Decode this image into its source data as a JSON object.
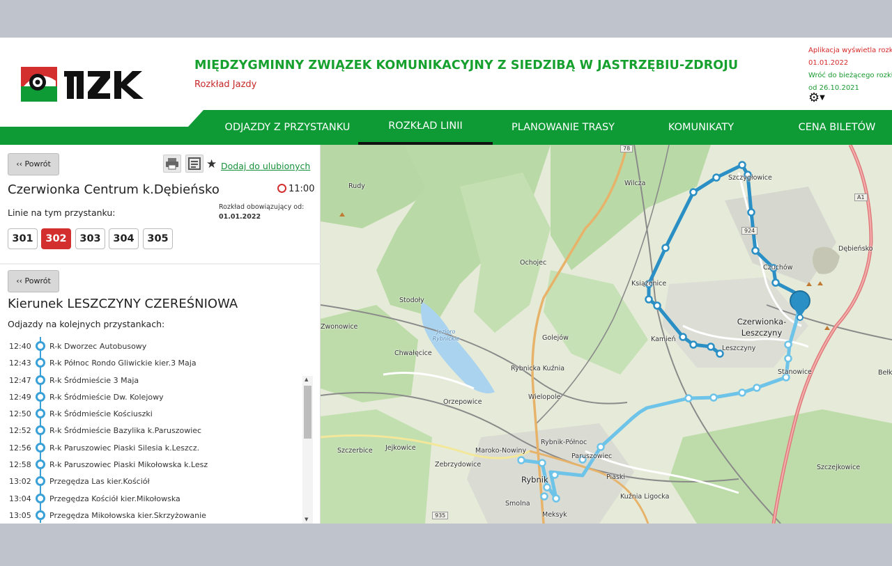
{
  "header": {
    "logo_text": "MZK",
    "org_title": "MIĘDZYGMINNY ZWIĄZEK KOMUNIKACYJNY Z SIEDZIBĄ W JASTRZĘBIU-ZDROJU",
    "org_subtitle": "Rozkład Jazdy",
    "notice_line1": "Aplikacja wyświetla rozkł",
    "notice_line2": "01.01.2022",
    "notice_line3": "Wróć do bieżącego rozkła",
    "notice_line4": "od 26.10.2021"
  },
  "nav": {
    "items": [
      "ODJAZDY Z PRZYSTANKU",
      "ROZKŁAD LINII",
      "PLANOWANIE TRASY",
      "KOMUNIKATY",
      "CENA BILETÓW"
    ],
    "active_index": 1
  },
  "stop_panel": {
    "back_label": "‹‹ Powrót",
    "favorite_label": "Dodaj do ulubionych",
    "stop_name": "Czerwionka Centrum k.Dębieńsko",
    "time": "11:00",
    "valid_label": "Rozkład obowiązujący od:",
    "valid_date": "01.01.2022",
    "lines_label": "Linie na tym przystanku:",
    "lines": [
      "301",
      "302",
      "303",
      "304",
      "305"
    ],
    "active_line": "302"
  },
  "direction_panel": {
    "back_label": "‹‹ Powrót",
    "direction": "Kierunek LESZCZYNY CZEREŚNIOWA",
    "departures_label": "Odjazdy na kolejnych przystankach:",
    "stops": [
      {
        "time": "12:40",
        "name": "R-k Dworzec Autobusowy"
      },
      {
        "time": "12:43",
        "name": "R-k Północ Rondo Gliwickie kier.3 Maja"
      },
      {
        "time": "12:47",
        "name": "R-k Śródmieście 3 Maja"
      },
      {
        "time": "12:49",
        "name": "R-k Śródmieście Dw. Kolejowy"
      },
      {
        "time": "12:50",
        "name": "R-k Śródmieście Kościuszki"
      },
      {
        "time": "12:52",
        "name": "R-k Śródmieście Bazylika k.Paruszowiec"
      },
      {
        "time": "12:56",
        "name": "R-k Paruszowiec Piaski Silesia k.Leszcz."
      },
      {
        "time": "12:58",
        "name": "R-k Paruszowiec Piaski Mikołowska k.Lesz"
      },
      {
        "time": "13:02",
        "name": "Przegędza Las kier.Kościół"
      },
      {
        "time": "13:04",
        "name": "Przegędza Kościół kier.Mikołowska"
      },
      {
        "time": "13:05",
        "name": "Przegędza Mikołowska kier.Skrzyżowanie"
      }
    ]
  },
  "map": {
    "places": [
      "Rudy",
      "Wilcza",
      "Szczygłowice",
      "Dębieńsko",
      "Ochojec",
      "Książenice",
      "Czuchów",
      "Stodoły",
      "Czerwionka-Leszczyny",
      "Zwonowice",
      "Chwałęcice",
      "Golejów",
      "Kamień",
      "Leszczyny",
      "Jezioro Rybnickie",
      "Rybnicka Kuźnia",
      "Stanowice",
      "Orzepowice",
      "Wielopole",
      "Szczerbice",
      "Jejkowice",
      "Maroko-Nowiny",
      "Rybnik-Północ",
      "Paruszowiec",
      "Zebrzydowice",
      "Rybnik",
      "Piaski",
      "Smolna",
      "Kuźnia Ligocka",
      "Meksyk",
      "Szczejkowice",
      "Bełk"
    ],
    "road_numbers": [
      "78",
      "A1",
      "924",
      "935"
    ],
    "colors": {
      "route_dark": "#2a8fc4",
      "route_light": "#6ec3e8",
      "motorway": "#e07a7a"
    }
  },
  "colors": {
    "brand_green": "#0e9a35",
    "brand_red": "#d32f2f"
  }
}
